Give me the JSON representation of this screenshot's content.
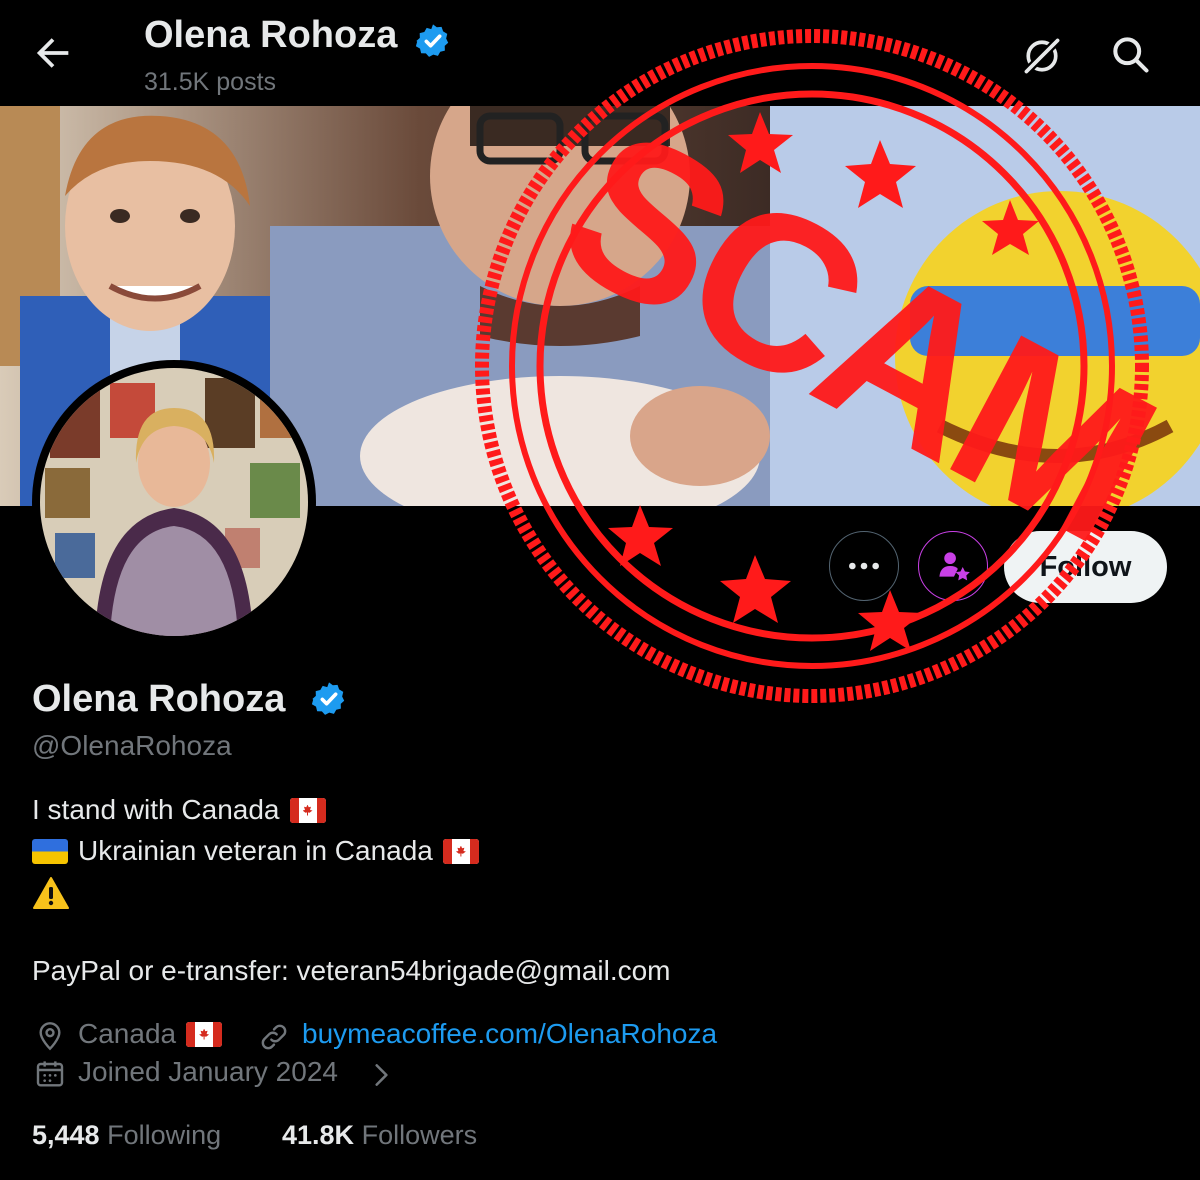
{
  "header": {
    "name": "Olena Rohoza",
    "posts": "31.5K posts"
  },
  "profile": {
    "name": "Olena Rohoza",
    "handle": "@OlenaRohoza",
    "bio": {
      "line1": "I stand with Canada",
      "line2": "Ukrainian veteran in Canada",
      "payment": "PayPal or e-transfer: veteran54brigade@gmail.com"
    },
    "location": "Canada",
    "website": "buymeacoffee.com/OlenaRohoza",
    "joined": "Joined January 2024",
    "following_count": "5,448",
    "following_label": "Following",
    "followers_count": "41.8K",
    "followers_label": "Followers"
  },
  "actions": {
    "follow_label": "Follow"
  },
  "overlay": {
    "stamp_text": "SCAM"
  },
  "icons": [
    "back-arrow-icon",
    "verified-badge-icon",
    "grok-icon",
    "search-icon",
    "more-icon",
    "subscribe-icon",
    "location-icon",
    "link-icon",
    "calendar-icon",
    "chevron-right-icon",
    "warning-icon",
    "canada-flag-icon",
    "ukraine-flag-icon"
  ],
  "colors": {
    "background": "#000000",
    "text": "#e7e9ea",
    "muted": "#71767b",
    "link": "#1d9bf0",
    "verified": "#1d9bf0",
    "subscribe": "#c940e6",
    "stamp": "#ff1a1a"
  }
}
